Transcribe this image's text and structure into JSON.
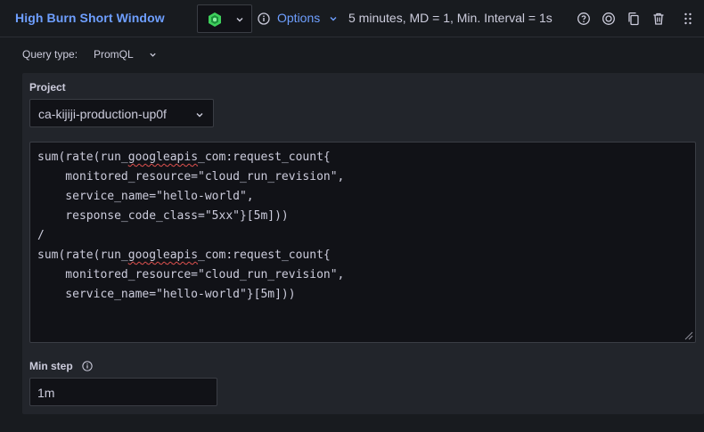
{
  "header": {
    "title": "High Burn Short Window",
    "options_label": "Options",
    "options_summary": "5 minutes, MD = 1, Min. Interval = 1s",
    "datasource_icon": "google-cloud-monitoring-icon",
    "icons": [
      "help-icon",
      "inspect-icon",
      "copy-icon",
      "delete-icon",
      "drag-handle-icon"
    ]
  },
  "query_type": {
    "label": "Query type:",
    "value": "PromQL"
  },
  "project": {
    "label": "Project",
    "value": "ca-kijiji-production-up0f"
  },
  "query": {
    "lines": [
      {
        "pre": "sum(rate(run_",
        "flag": "googleapis",
        "post": "_com:request_count{"
      },
      {
        "pre": "    monitored_resource=\"cloud_run_revision\",",
        "flag": "",
        "post": ""
      },
      {
        "pre": "    service_name=\"hello-world\",",
        "flag": "",
        "post": ""
      },
      {
        "pre": "    response_code_class=\"5xx\"}[5m]))",
        "flag": "",
        "post": ""
      },
      {
        "pre": "/",
        "flag": "",
        "post": ""
      },
      {
        "pre": "sum(rate(run_",
        "flag": "googleapis",
        "post": "_com:request_count{"
      },
      {
        "pre": "    monitored_resource=\"cloud_run_revision\",",
        "flag": "",
        "post": ""
      },
      {
        "pre": "    service_name=\"hello-world\"}[5m]))",
        "flag": "",
        "post": ""
      }
    ]
  },
  "min_step": {
    "label": "Min step",
    "value": "1m"
  },
  "colors": {
    "accent": "#6e9fff",
    "panel": "#22252b",
    "background": "#181b1f",
    "input_bg": "#111217",
    "spellcheck": "#e0524f"
  }
}
